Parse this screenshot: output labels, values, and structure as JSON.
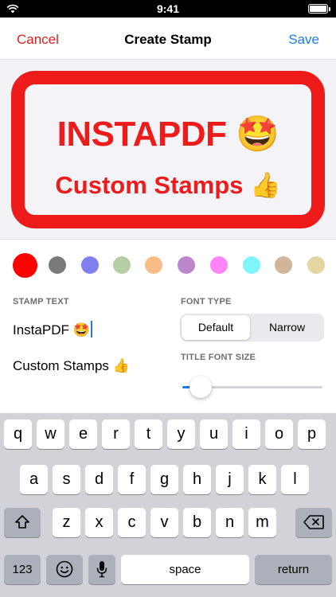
{
  "status_bar": {
    "time": "9:41"
  },
  "nav": {
    "cancel_label": "Cancel",
    "title": "Create Stamp",
    "save_label": "Save"
  },
  "preview": {
    "title": "INSTAPDF 🤩",
    "subtitle": "Custom Stamps 👍",
    "border_color": "#ee1b1b"
  },
  "colors": [
    "#ff0000",
    "#7a7a7a",
    "#7f7ff0",
    "#b5cea5",
    "#f8bd86",
    "#bd86cb",
    "#ff84f7",
    "#7ff6fc",
    "#d1b59a",
    "#e4d5a1"
  ],
  "selected_color_index": 0,
  "form": {
    "stamp_text_label": "STAMP TEXT",
    "line1": "InstaPDF 🤩",
    "line2": "Custom Stamps 👍",
    "font_type_label": "FONT TYPE",
    "font_options": [
      "Default",
      "Narrow"
    ],
    "font_selected": "Default",
    "title_size_label": "TITLE FONT SIZE",
    "title_size_fraction": 0.13
  },
  "keyboard": {
    "row1": [
      "q",
      "w",
      "e",
      "r",
      "t",
      "y",
      "u",
      "i",
      "o",
      "p"
    ],
    "row2": [
      "a",
      "s",
      "d",
      "f",
      "g",
      "h",
      "j",
      "k",
      "l"
    ],
    "row3": [
      "z",
      "x",
      "c",
      "v",
      "b",
      "n",
      "m"
    ],
    "numbers_label": "123",
    "space_label": "space",
    "return_label": "return",
    "icons": {
      "shift": "shift-icon",
      "delete": "delete-icon",
      "emoji": "emoji-icon",
      "mic": "microphone-icon"
    }
  }
}
